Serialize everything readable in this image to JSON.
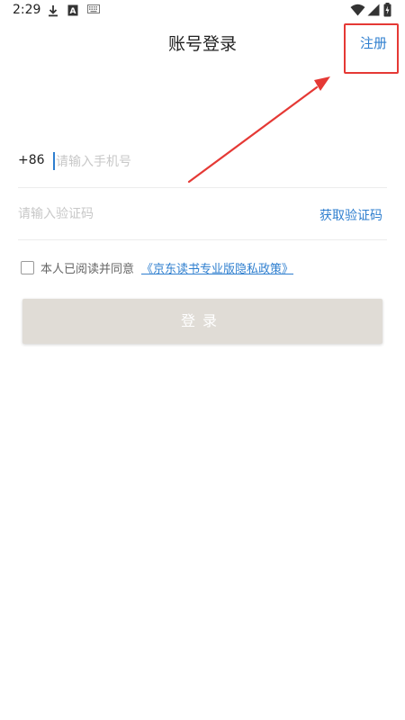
{
  "status_bar": {
    "time": "2:29",
    "icons": [
      "download-icon",
      "a-notification-icon",
      "keyboard-icon",
      "wifi-icon",
      "signal-icon",
      "battery-charging-icon"
    ]
  },
  "header": {
    "title": "账号登录",
    "register_label": "注册"
  },
  "form": {
    "country_code": "+86",
    "phone_placeholder": "请输入手机号",
    "code_placeholder": "请输入验证码",
    "get_code_label": "获取验证码",
    "agree_text": "本人已阅读并同意",
    "policy_link": "《京东读书专业版隐私政策》",
    "agree_checked": false,
    "login_label": "登录"
  },
  "annotation": {
    "color": "#e53935"
  },
  "colors": {
    "accent": "#2f7fcf",
    "button_bg": "#e0dcd6"
  }
}
